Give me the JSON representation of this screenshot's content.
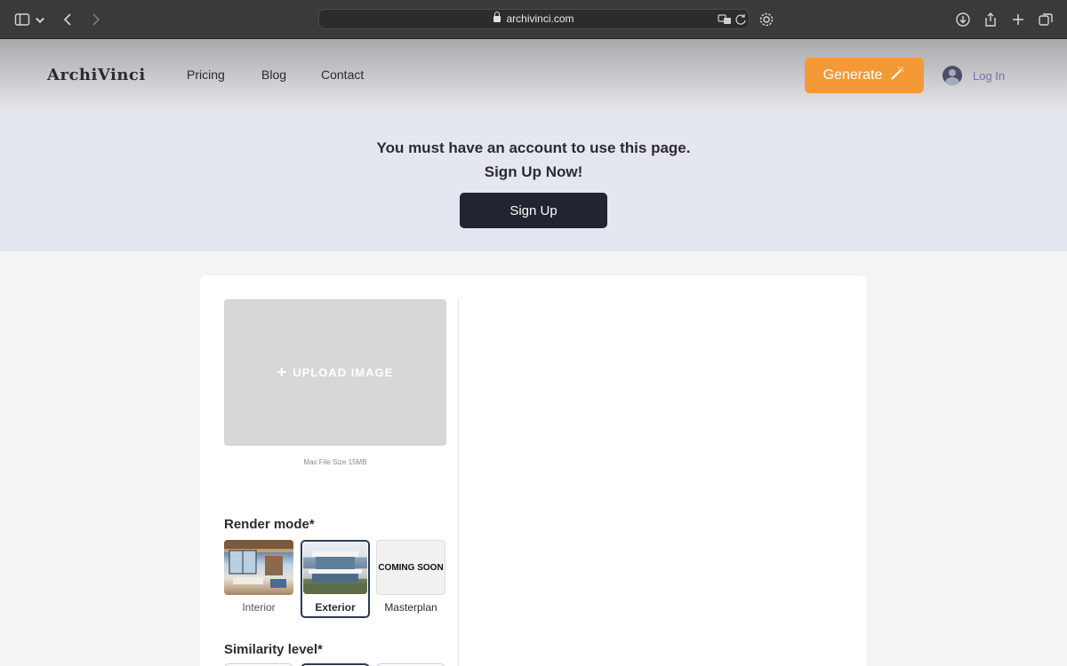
{
  "browser": {
    "url": "archivinci.com"
  },
  "header": {
    "logo": "ArchiVinci",
    "nav": [
      "Pricing",
      "Blog",
      "Contact"
    ],
    "generate_label": "Generate",
    "login_label": "Log In"
  },
  "banner": {
    "line1": "You must have an account to use this page.",
    "line2": "Sign Up Now!",
    "signup_label": "Sign Up"
  },
  "upload": {
    "label": "UPLOAD IMAGE",
    "max_size": "Max File Size 15MB"
  },
  "render_mode": {
    "title": "Render mode*",
    "options": [
      {
        "label": "Interior",
        "selected": false
      },
      {
        "label": "Exterior",
        "selected": true
      },
      {
        "label": "Masterplan",
        "selected": false,
        "overlay": "COMING SOON"
      }
    ]
  },
  "similarity": {
    "title": "Similarity level*"
  },
  "colors": {
    "accent": "#f39a36",
    "dark_button": "#222431",
    "banner_bg": "#e4e6f0",
    "selected_border": "#2e3a52"
  }
}
